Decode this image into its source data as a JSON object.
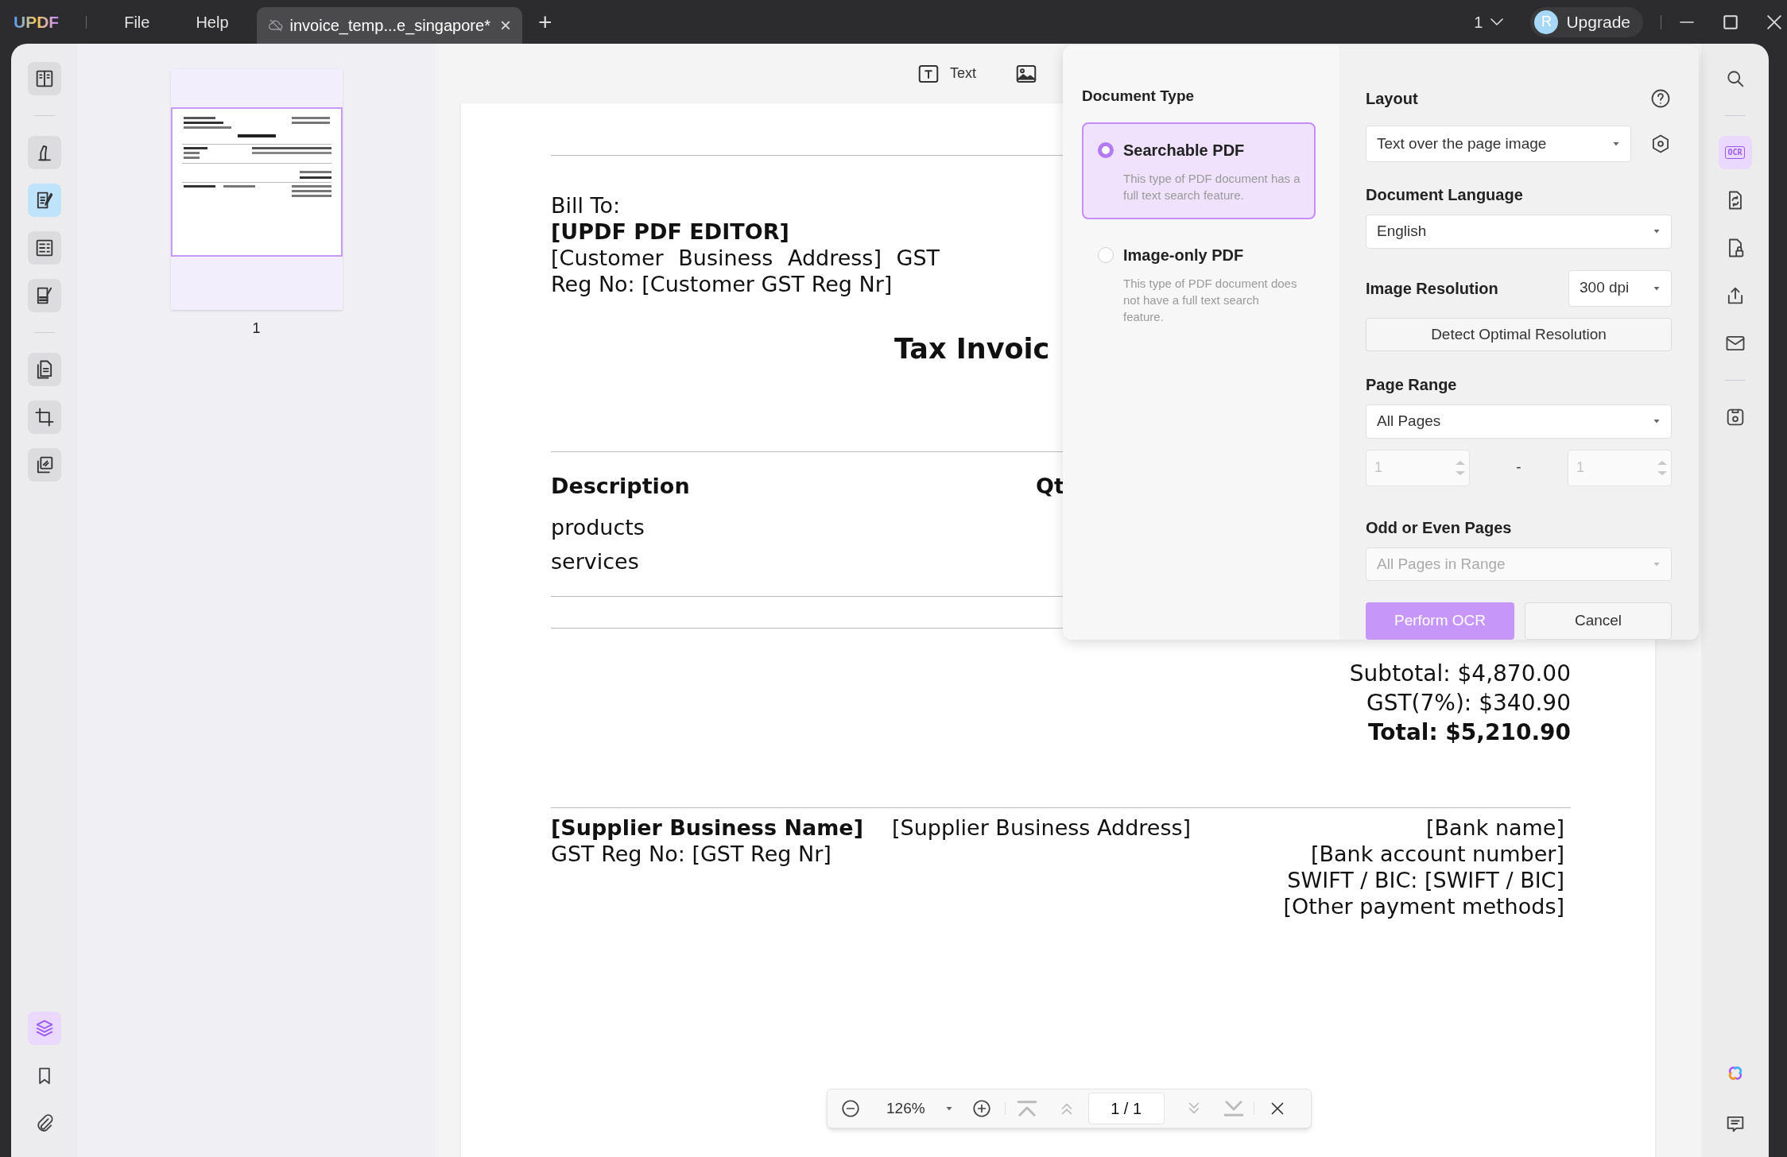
{
  "title_bar": {
    "logo": "UPDF",
    "menu": [
      {
        "label": "File"
      },
      {
        "label": "Help"
      }
    ],
    "tabs": [
      {
        "label": "invoice_temp...e_singapore*",
        "selected": true,
        "close": "×"
      }
    ],
    "new_tab": "+",
    "page_selector": "1",
    "upgrade": {
      "avatar": "R",
      "label": "Upgrade"
    }
  },
  "left_toolbar": {
    "top": [
      {
        "kind": "reader",
        "selected": false
      },
      {
        "kind": "divider"
      },
      {
        "kind": "comment",
        "selected": false
      },
      {
        "kind": "edit",
        "selected": true
      },
      {
        "kind": "form",
        "selected": false
      },
      {
        "kind": "sign",
        "selected": false
      },
      {
        "kind": "divider"
      },
      {
        "kind": "organize",
        "selected": false
      },
      {
        "kind": "crop",
        "selected": false
      },
      {
        "kind": "stack",
        "selected": false
      }
    ],
    "bottom": [
      {
        "kind": "layers",
        "selected": true
      },
      {
        "kind": "bookmark",
        "selected": false
      },
      {
        "kind": "attachment",
        "selected": false
      }
    ]
  },
  "thumbnails": [
    {
      "label": "1",
      "selected": true
    }
  ],
  "edit_toolbar": [
    {
      "kind": "text",
      "label": "Text"
    },
    {
      "kind": "image"
    }
  ],
  "document": {
    "bill_to_label": "Bill To:",
    "company": "[UPDF PDF EDITOR]",
    "address_lines": [
      "[Customer Business Address] GST",
      "Reg No: [Customer GST Reg Nr]"
    ],
    "title": "Tax Invoic",
    "table_header": [
      "Description",
      "Qt"
    ],
    "rows": [
      "products",
      "services"
    ],
    "subtotal": "Subtotal: $4,870.00",
    "gst": "GST(7%): $340.90",
    "total": "Total: $5,210.90",
    "supplier_name": "[Supplier Business Name]",
    "supplier_reg": "GST Reg No: [GST Reg Nr]",
    "supplier_address": "[Supplier Business Address]",
    "bank_lines": [
      "[Bank name]",
      "[Bank account number]",
      "SWIFT / BIC: [SWIFT / BIC]",
      "[Other payment methods]"
    ]
  },
  "ocr_panel": {
    "document_type": {
      "heading": "Document Type",
      "options": [
        {
          "label": "Searchable PDF",
          "description": "This type of PDF document has a full text search feature.",
          "selected": true
        },
        {
          "label": "Image-only PDF",
          "description": "This type of PDF document does not have a full text search feature.",
          "selected": false
        }
      ]
    },
    "layout": {
      "label": "Layout",
      "value": "Text over the page image"
    },
    "language": {
      "label": "Document Language",
      "value": "English"
    },
    "resolution": {
      "label": "Image Resolution",
      "value": "300 dpi"
    },
    "detect_button": "Detect Optimal Resolution",
    "page_range": {
      "label": "Page Range",
      "value": "All Pages",
      "from": {
        "placeholder": "1"
      },
      "separator": "-",
      "to": {
        "placeholder": "1"
      },
      "disabled": true
    },
    "odd_even": {
      "label": "Odd or Even Pages",
      "value": "All Pages in Range",
      "disabled": true
    },
    "perform_button": "Perform OCR",
    "cancel_button": "Cancel"
  },
  "right_toolbar": {
    "top": [
      {
        "kind": "search",
        "selected": false
      },
      {
        "kind": "divider"
      },
      {
        "kind": "ocr",
        "label": "OCR",
        "selected": true
      },
      {
        "kind": "convert",
        "selected": false
      },
      {
        "kind": "protect",
        "selected": false
      },
      {
        "kind": "share",
        "selected": false
      },
      {
        "kind": "email",
        "selected": false
      },
      {
        "kind": "divider"
      },
      {
        "kind": "save",
        "selected": false
      }
    ],
    "bottom": [
      {
        "kind": "ai",
        "selected": false
      },
      {
        "kind": "comment",
        "selected": false
      }
    ]
  },
  "zoom_bar": {
    "zoom": "126%",
    "page": "1 / 1"
  }
}
